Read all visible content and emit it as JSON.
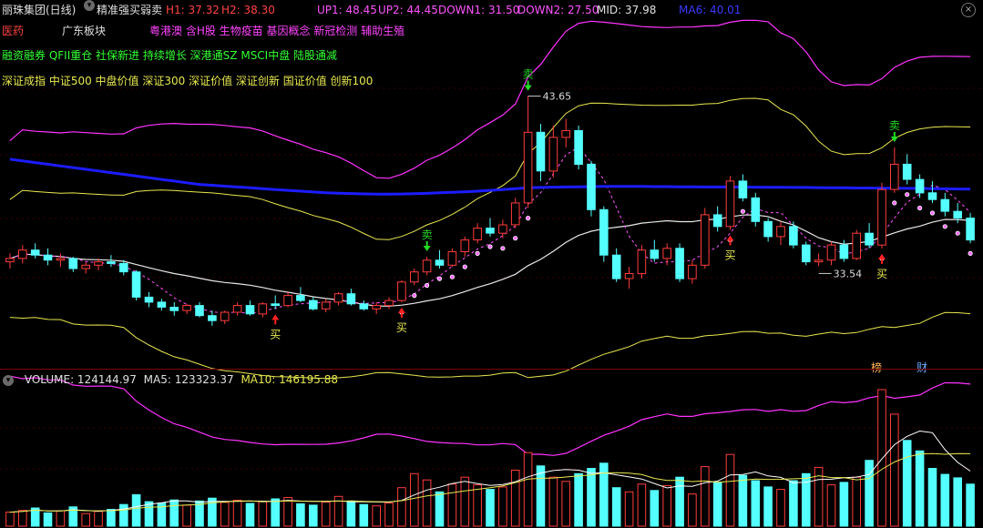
{
  "header": {
    "stock_name": "丽珠集团(日线)",
    "indicator_name": "精准强买弱卖",
    "h1_label": "H1: 37.32",
    "h2_label": "H2: 38.30",
    "up1_label": "UP1: 48.45",
    "up2_label": "UP2: 44.45",
    "down1_label": "DOWN1: 31.50",
    "down2_label": "DOWN2: 27.50",
    "mid_label": "MID: 37.98",
    "ma6_label": "MA6: 40.01"
  },
  "tags": {
    "industry": "医药",
    "region": "广东板块",
    "concepts_pink": "粤港澳 含H股 生物疫苗 基因概念 新冠检测 辅助生殖",
    "concepts_green": "融资融券 QFII重仓 社保新进 持续增长 深港通SZ MSCI中盘 陆股通减",
    "indexes_yellow": "深证成指 中证500 中盘价值 深证300 深证价值 深证创新 国证价值 创新100"
  },
  "annotations": {
    "buy": "买",
    "sell": "卖",
    "high_price": "43.65",
    "low_price": "33.54",
    "tab_rank": "榜",
    "tab_finance": "财"
  },
  "volume_header": {
    "volume_label": "VOLUME: 124144.97",
    "ma5_label": "MA5: 123323.37",
    "ma10_label": "MA10: 146195.88"
  },
  "colors": {
    "up": "#ff3c3c",
    "down": "#54ffff",
    "ma6": "#1c1cff",
    "bands": "#ff33ff",
    "yellow": "#e8e850",
    "green_text": "#33ff33"
  },
  "chart_data": {
    "type": "candlestick",
    "price_range": [
      27.5,
      48.5
    ],
    "buy_signal_candles": [
      21,
      31,
      57,
      69
    ],
    "sell_signal_candles": [
      33,
      41,
      70
    ],
    "candles": [
      [
        33.8,
        34.3,
        33.4,
        34.0
      ],
      [
        34.0,
        34.8,
        33.7,
        34.5
      ],
      [
        34.5,
        34.9,
        34.0,
        34.2
      ],
      [
        34.2,
        34.6,
        33.6,
        33.9
      ],
      [
        33.9,
        34.3,
        33.5,
        34.0
      ],
      [
        34.0,
        34.1,
        33.2,
        33.4
      ],
      [
        33.4,
        33.8,
        33.1,
        33.6
      ],
      [
        33.6,
        34.0,
        33.3,
        33.8
      ],
      [
        33.8,
        34.2,
        33.5,
        33.7
      ],
      [
        33.7,
        33.9,
        33.0,
        33.2
      ],
      [
        33.2,
        33.3,
        31.5,
        31.7
      ],
      [
        31.7,
        32.0,
        31.1,
        31.4
      ],
      [
        31.4,
        31.6,
        30.9,
        31.1
      ],
      [
        31.1,
        31.4,
        30.6,
        30.9
      ],
      [
        30.9,
        31.3,
        30.7,
        31.2
      ],
      [
        31.2,
        31.4,
        30.5,
        30.6
      ],
      [
        30.6,
        30.9,
        30.0,
        30.3
      ],
      [
        30.3,
        30.9,
        30.1,
        30.8
      ],
      [
        30.8,
        31.4,
        30.6,
        31.2
      ],
      [
        31.2,
        31.5,
        30.6,
        30.7
      ],
      [
        30.7,
        31.4,
        30.5,
        31.3
      ],
      [
        31.3,
        31.8,
        31.0,
        31.2
      ],
      [
        31.2,
        32.0,
        31.1,
        31.8
      ],
      [
        31.8,
        32.3,
        31.4,
        31.5
      ],
      [
        31.5,
        31.7,
        30.9,
        31.0
      ],
      [
        31.0,
        31.6,
        30.8,
        31.4
      ],
      [
        31.4,
        32.0,
        31.2,
        31.9
      ],
      [
        31.9,
        32.2,
        31.2,
        31.3
      ],
      [
        31.3,
        31.5,
        30.9,
        31.0
      ],
      [
        31.0,
        31.4,
        30.7,
        31.2
      ],
      [
        31.2,
        31.7,
        31.0,
        31.5
      ],
      [
        31.5,
        32.7,
        31.4,
        32.6
      ],
      [
        32.6,
        33.4,
        32.4,
        33.2
      ],
      [
        33.2,
        34.1,
        33.0,
        33.9
      ],
      [
        33.9,
        34.5,
        33.4,
        33.6
      ],
      [
        33.6,
        34.6,
        33.5,
        34.4
      ],
      [
        34.4,
        35.3,
        34.1,
        35.1
      ],
      [
        35.1,
        36.1,
        34.9,
        35.8
      ],
      [
        35.8,
        36.4,
        35.3,
        35.5
      ],
      [
        35.5,
        36.3,
        35.2,
        36.0
      ],
      [
        36.0,
        37.6,
        35.8,
        37.3
      ],
      [
        37.3,
        43.65,
        37.0,
        41.5
      ],
      [
        41.5,
        42.0,
        38.6,
        39.2
      ],
      [
        39.2,
        41.9,
        38.8,
        41.2
      ],
      [
        41.2,
        42.3,
        40.6,
        41.6
      ],
      [
        41.6,
        41.9,
        39.3,
        39.6
      ],
      [
        39.6,
        39.8,
        36.5,
        36.9
      ],
      [
        36.9,
        37.1,
        33.8,
        34.2
      ],
      [
        34.2,
        34.6,
        32.6,
        32.8
      ],
      [
        32.8,
        33.5,
        32.2,
        33.1
      ],
      [
        33.1,
        34.8,
        32.8,
        34.5
      ],
      [
        34.5,
        35.1,
        33.8,
        34.0
      ],
      [
        34.0,
        34.9,
        33.6,
        34.6
      ],
      [
        34.6,
        34.9,
        32.6,
        32.8
      ],
      [
        32.8,
        33.9,
        32.5,
        33.6
      ],
      [
        33.6,
        37.0,
        33.4,
        36.6
      ],
      [
        36.6,
        37.1,
        35.6,
        35.9
      ],
      [
        35.9,
        38.9,
        35.7,
        38.6
      ],
      [
        38.6,
        39.0,
        37.4,
        37.6
      ],
      [
        37.6,
        37.9,
        35.9,
        36.2
      ],
      [
        36.2,
        36.4,
        35.0,
        35.3
      ],
      [
        35.3,
        36.2,
        34.8,
        35.9
      ],
      [
        35.9,
        36.2,
        34.6,
        34.8
      ],
      [
        34.8,
        35.0,
        33.6,
        33.8
      ],
      [
        33.8,
        34.3,
        33.54,
        33.9
      ],
      [
        33.9,
        35.0,
        33.6,
        34.8
      ],
      [
        34.8,
        35.1,
        33.8,
        34.0
      ],
      [
        34.0,
        35.7,
        33.9,
        35.5
      ],
      [
        35.5,
        36.1,
        34.6,
        34.8
      ],
      [
        34.8,
        38.5,
        34.6,
        38.1
      ],
      [
        38.1,
        40.6,
        37.9,
        39.6
      ],
      [
        39.6,
        40.2,
        38.4,
        38.7
      ],
      [
        38.7,
        39.0,
        37.6,
        37.9
      ],
      [
        37.9,
        38.6,
        37.3,
        37.5
      ],
      [
        37.5,
        37.9,
        36.5,
        36.8
      ],
      [
        36.8,
        37.3,
        36.1,
        36.4
      ],
      [
        36.4,
        36.7,
        34.9,
        35.1
      ]
    ],
    "ma6": [
      39.9,
      39.8,
      39.7,
      39.6,
      39.5,
      39.4,
      39.3,
      39.2,
      39.1,
      39.0,
      38.9,
      38.8,
      38.7,
      38.6,
      38.5,
      38.4,
      38.35,
      38.3,
      38.25,
      38.2,
      38.15,
      38.1,
      38.05,
      38.0,
      37.95,
      37.9,
      37.88,
      37.86,
      37.84,
      37.82,
      37.82,
      37.83,
      37.85,
      37.87,
      37.9,
      37.93,
      37.96,
      38.0,
      38.05,
      38.1,
      38.15,
      38.2,
      38.22,
      38.24,
      38.25,
      38.26,
      38.27,
      38.28,
      38.28,
      38.28,
      38.28,
      38.27,
      38.27,
      38.26,
      38.26,
      38.25,
      38.25,
      38.25,
      38.24,
      38.24,
      38.23,
      38.23,
      38.22,
      38.22,
      38.21,
      38.2,
      38.2,
      38.19,
      38.19,
      38.18,
      38.18,
      38.17,
      38.16,
      38.15,
      38.14,
      38.13,
      38.12
    ],
    "volume_range": [
      0,
      390000
    ],
    "volume": [
      40000,
      45000,
      52000,
      38000,
      44000,
      55000,
      36000,
      42000,
      48000,
      62000,
      90000,
      70000,
      66000,
      75000,
      60000,
      72000,
      80000,
      68000,
      74000,
      65000,
      70000,
      78000,
      82000,
      64000,
      60000,
      69000,
      85000,
      72000,
      62000,
      58000,
      66000,
      110000,
      150000,
      132000,
      98000,
      120000,
      140000,
      118000,
      105000,
      112000,
      160000,
      210000,
      172000,
      140000,
      128000,
      150000,
      165000,
      180000,
      110000,
      98000,
      120000,
      102000,
      116000,
      140000,
      92000,
      170000,
      125000,
      205000,
      145000,
      130000,
      112000,
      105000,
      130000,
      150000,
      168000,
      118000,
      125000,
      140000,
      188000,
      390000,
      320000,
      245000,
      215000,
      165000,
      148000,
      138000,
      120000
    ]
  }
}
